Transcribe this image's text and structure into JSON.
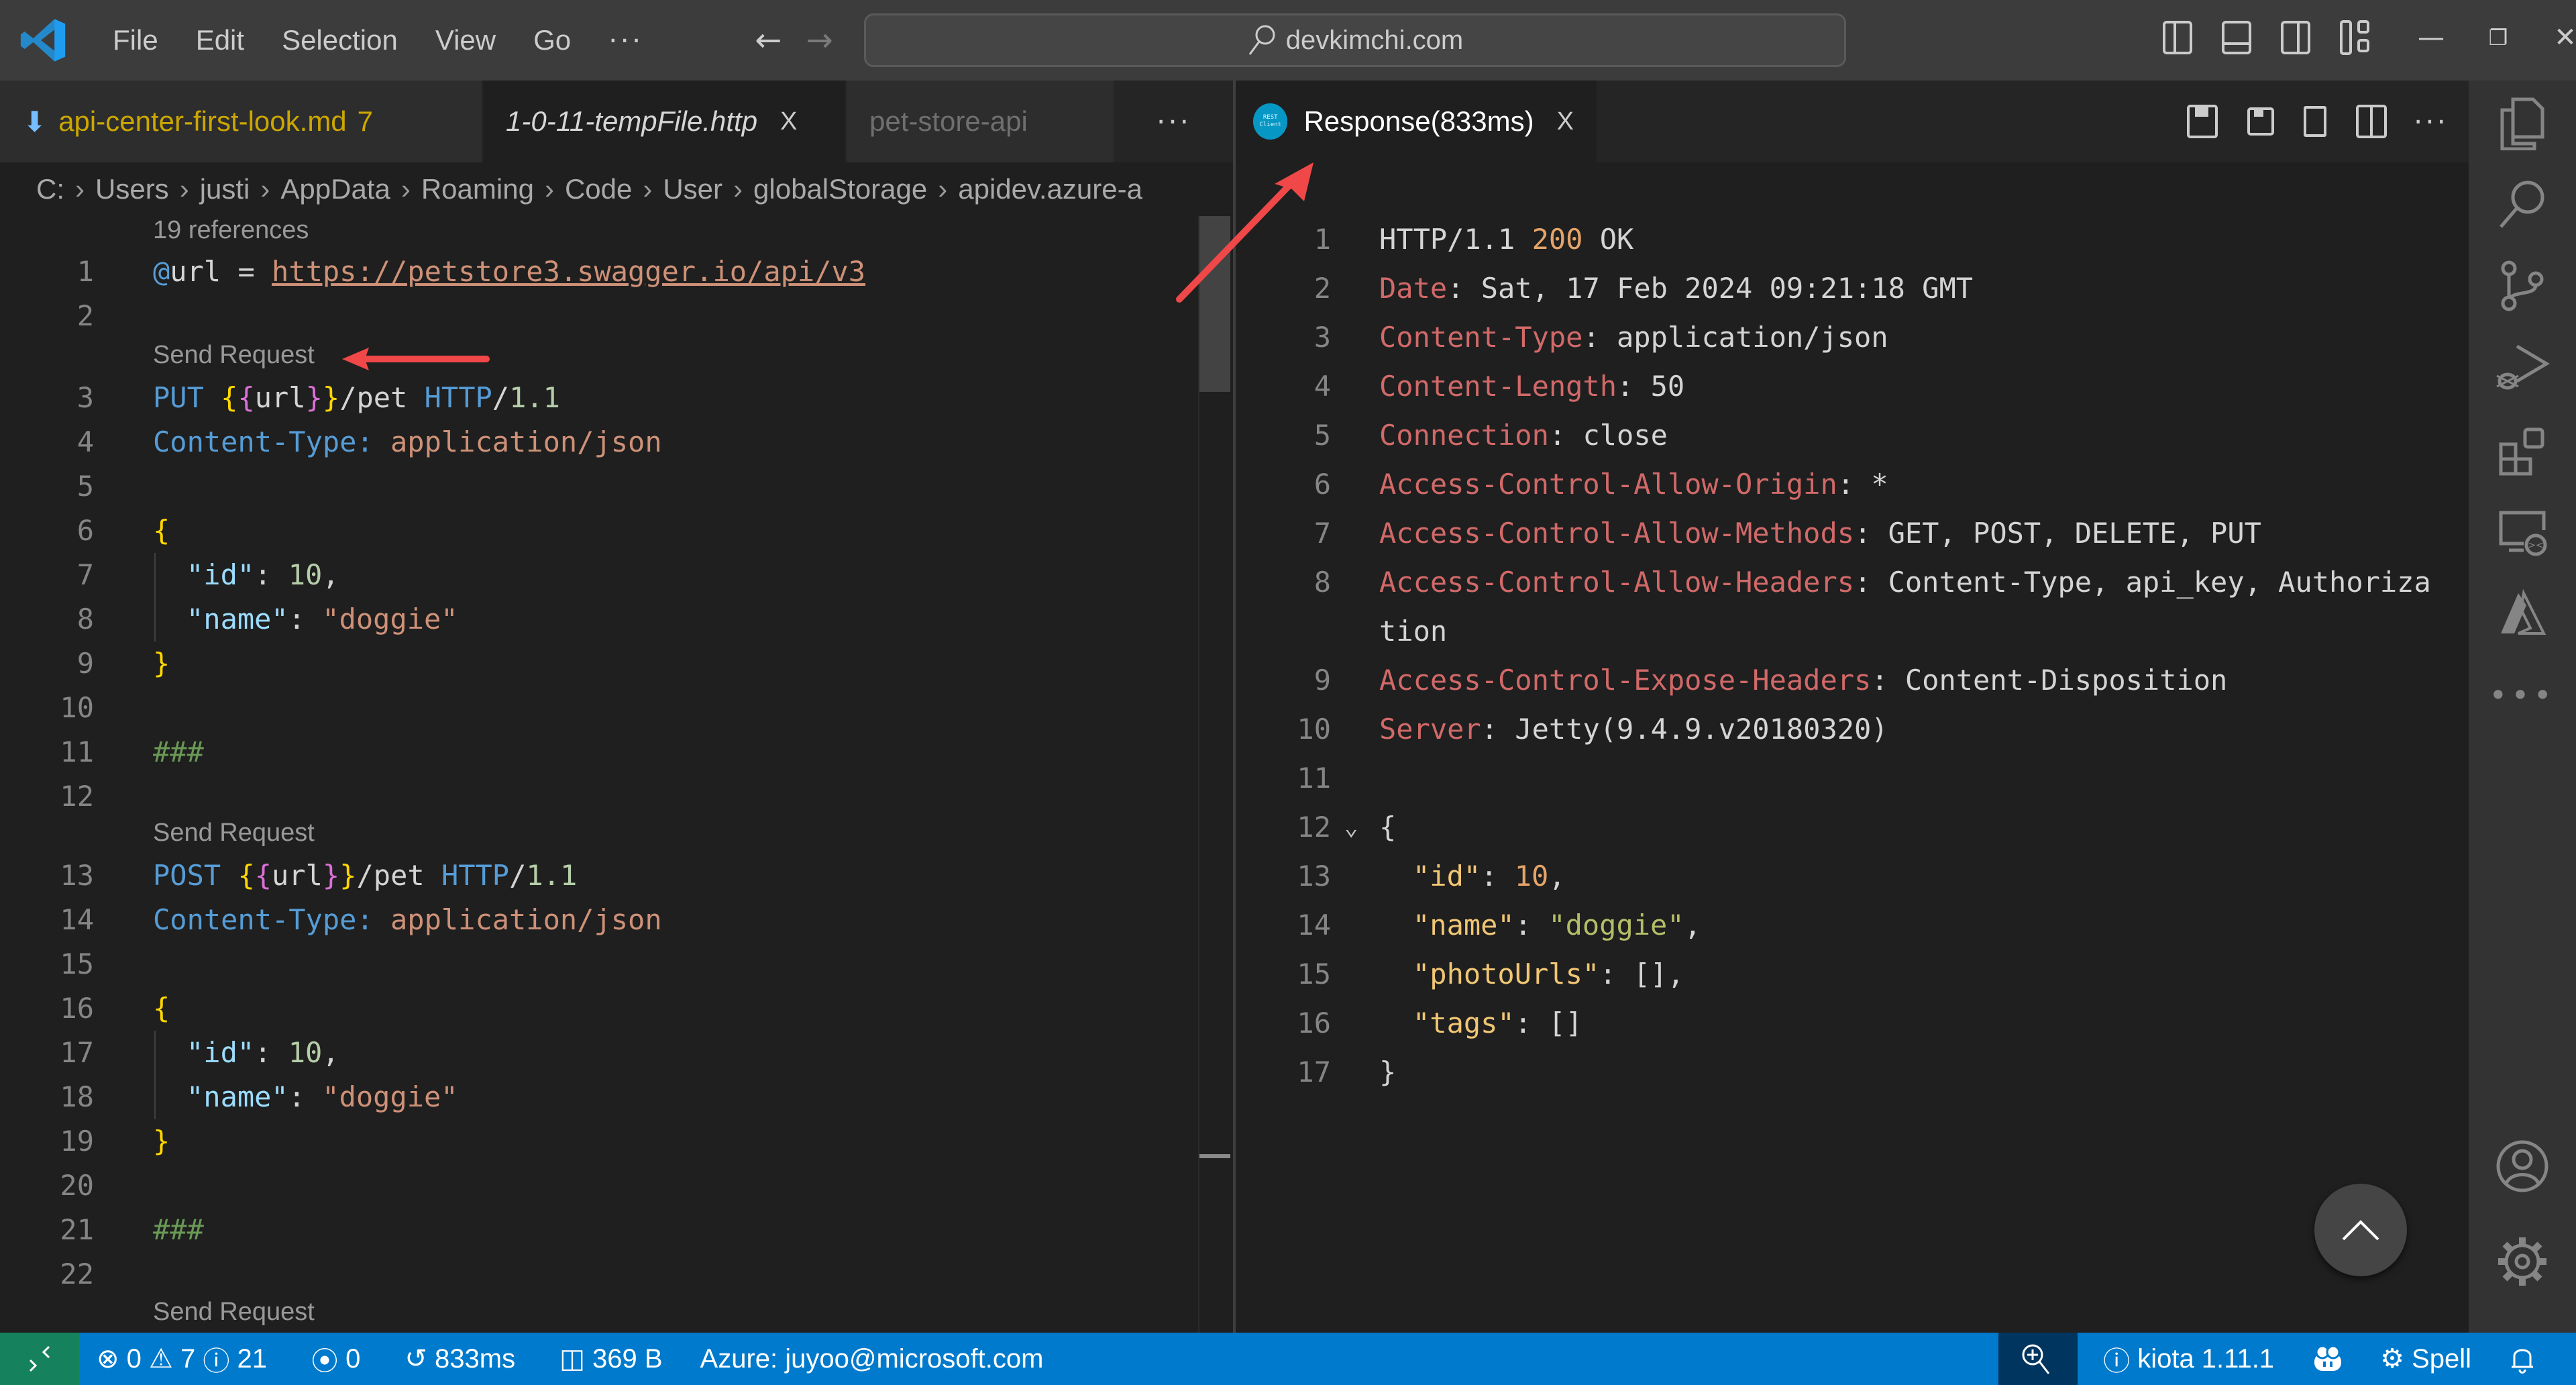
{
  "titlebar": {
    "menus": [
      "File",
      "Edit",
      "Selection",
      "View",
      "Go"
    ],
    "more": "···",
    "search_text": "devkimchi.com"
  },
  "left_editor": {
    "tabs": [
      {
        "label": "api-center-first-look.md",
        "badge": "7",
        "state": "warning"
      },
      {
        "label": "1-0-11-tempFile.http",
        "close": "X",
        "state": "active"
      },
      {
        "label": "pet-store-api",
        "state": "inactive"
      }
    ],
    "more": "···",
    "breadcrumb": [
      "C:",
      "Users",
      "justi",
      "AppData",
      "Roaming",
      "Code",
      "User",
      "globalStorage",
      "apidev.azure-a"
    ],
    "codelens": {
      "references": "19 references",
      "send_request": "Send Request"
    },
    "lines": {
      "l1_at": "@",
      "l1_var": "url",
      "l1_eq": " = ",
      "l1_url": "https://petstore3.swagger.io/api/v3",
      "method_put": "PUT",
      "method_post": "POST",
      "ob": "{",
      "cb": "}",
      "url_var": "url",
      "path": "/pet ",
      "http": "HTTP",
      "slash": "/",
      "ver": "1.1",
      "ct_key": "Content-Type:",
      "ct_val": " application/json",
      "brace_open": "{",
      "brace_close": "}",
      "id_key": "\"id\"",
      "colon": ": ",
      "id_val": "10",
      "comma": ",",
      "name_key": "\"name\"",
      "name_val": "\"doggie\"",
      "separator": "###"
    },
    "line_numbers": [
      "1",
      "2",
      "3",
      "4",
      "5",
      "6",
      "7",
      "8",
      "9",
      "10",
      "11",
      "12",
      "13",
      "14",
      "15",
      "16",
      "17",
      "18",
      "19",
      "20",
      "21",
      "22"
    ]
  },
  "right_editor": {
    "tab": {
      "label": "Response(833ms)",
      "close": "X",
      "icon_text_1": "REST",
      "icon_text_2": "Client"
    },
    "more": "···",
    "response": {
      "status_line": {
        "proto": "HTTP/1.1 ",
        "code": "200",
        "text": " OK"
      },
      "headers": [
        {
          "key": "Date",
          "value": " Sat, 17 Feb 2024 09:21:18 GMT"
        },
        {
          "key": "Content-Type",
          "value": " application/json"
        },
        {
          "key": "Content-Length",
          "value": " 50"
        },
        {
          "key": "Connection",
          "value": " close"
        },
        {
          "key": "Access-Control-Allow-Origin",
          "value": " *"
        },
        {
          "key": "Access-Control-Allow-Methods",
          "value": " GET, POST, DELETE, PUT"
        },
        {
          "key": "Access-Control-Allow-Headers",
          "value": " Content-Type, api_key, Authoriza",
          "wrap": "tion"
        },
        {
          "key": "Access-Control-Expose-Headers",
          "value": " Content-Disposition"
        },
        {
          "key": "Server",
          "value": " Jetty(9.4.9.v20180320)"
        }
      ],
      "body": {
        "open": "{",
        "close": "}",
        "fold_icon": "⌄",
        "fields": [
          {
            "key": "\"id\"",
            "value": "10",
            "type": "number",
            "trail": ","
          },
          {
            "key": "\"name\"",
            "value": "\"doggie\"",
            "type": "string",
            "trail": ","
          },
          {
            "key": "\"photoUrls\"",
            "value": "[]",
            "type": "array",
            "trail": ","
          },
          {
            "key": "\"tags\"",
            "value": "[]",
            "type": "array",
            "trail": ""
          }
        ]
      }
    },
    "line_numbers": [
      "1",
      "2",
      "3",
      "4",
      "5",
      "6",
      "7",
      "8",
      "9",
      "10",
      "11",
      "12",
      "13",
      "14",
      "15",
      "16",
      "17"
    ]
  },
  "statusbar": {
    "errors": "0",
    "warnings": "7",
    "infos": "21",
    "ports": "0",
    "elapsed": "833ms",
    "size": "369 B",
    "azure": "Azure: juyoo@microsoft.com",
    "kiota": "kiota 1.11.1",
    "spell": "Spell"
  },
  "colors": {
    "statusbar": "#007acc",
    "remote": "#16825d",
    "annotation_arrow": "#f04848"
  }
}
